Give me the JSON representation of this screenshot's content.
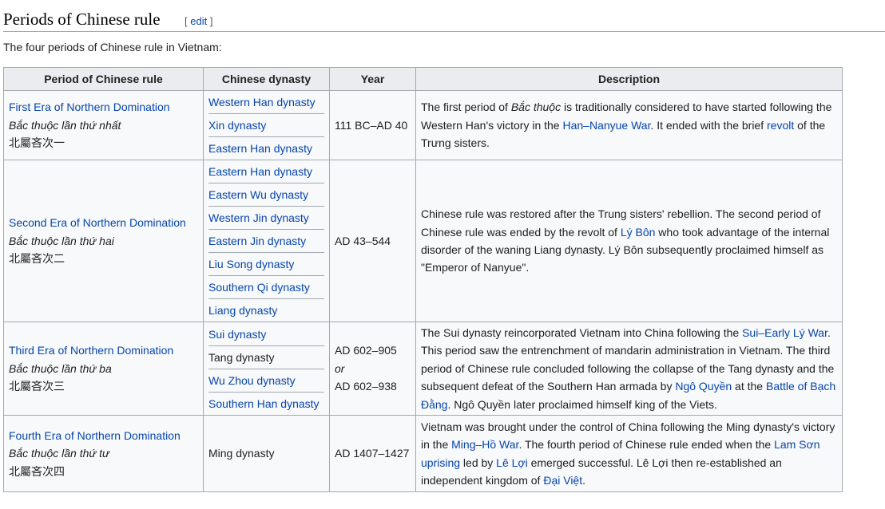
{
  "heading": {
    "title": "Periods of Chinese rule",
    "edit_open": "[",
    "edit_label": "edit",
    "edit_close": "]"
  },
  "intro": "The four periods of Chinese rule in Vietnam:",
  "table": {
    "headers": [
      "Period of Chinese rule",
      "Chinese dynasty",
      "Year",
      "Description"
    ],
    "rows": [
      {
        "period": "First Era of Northern Domination",
        "viet": "Bắc thuộc lần thứ nhất",
        "han": "北屬吝次一",
        "dynasties": [
          {
            "name": "Western Han dynasty",
            "link": true
          },
          {
            "name": "Xin dynasty",
            "link": true
          },
          {
            "name": "Eastern Han dynasty",
            "link": true
          }
        ],
        "year": "111 BC–AD 40",
        "desc": {
          "a": "The first period of ",
          "b": "Bắc thuộc",
          "c": " is traditionally considered to have started following the Western Han's victory in the ",
          "d": "Han–Nanyue War",
          "e": ". It ended with the brief ",
          "f": "revolt",
          "g": " of the ",
          "h": "Trưng sisters",
          "i": "."
        }
      },
      {
        "period": "Second Era of Northern Domination",
        "viet": "Bắc thuộc lần thứ hai",
        "han": "北屬吝次二",
        "dynasties": [
          {
            "name": "Eastern Han dynasty",
            "link": true
          },
          {
            "name": "Eastern Wu dynasty",
            "link": true
          },
          {
            "name": "Western Jin dynasty",
            "link": true
          },
          {
            "name": "Eastern Jin dynasty",
            "link": true
          },
          {
            "name": "Liu Song dynasty",
            "link": true
          },
          {
            "name": "Southern Qi dynasty",
            "link": true
          },
          {
            "name": "Liang dynasty",
            "link": true
          }
        ],
        "year": "AD 43–544",
        "desc": {
          "a": "Chinese rule was restored after the Trung sisters' rebellion. The second period of Chinese rule was ended by the revolt of ",
          "b": "Lý Bôn",
          "c": " who took advantage of the internal disorder of the waning Liang dynasty. Lý Bôn subsequently proclaimed himself as \"Emperor of Nanyue\"."
        }
      },
      {
        "period": "Third Era of Northern Domination",
        "viet": "Bắc thuộc lần thứ ba",
        "han": "北屬吝次三",
        "dynasties": [
          {
            "name": "Sui dynasty",
            "link": true
          },
          {
            "name": "Tang dynasty",
            "link": false
          },
          {
            "name": "Wu Zhou dynasty",
            "link": true
          },
          {
            "name": "Southern Han dynasty",
            "link": true
          }
        ],
        "year1": "AD 602–905",
        "year_or": "or",
        "year2": "AD 602–938",
        "desc": {
          "a": "The Sui dynasty reincorporated Vietnam into China following the ",
          "b": "Sui–Early Lý War",
          "c": ". This period saw the entrenchment of mandarin administration in Vietnam. The third period of Chinese rule concluded following the collapse of the Tang dynasty and the subsequent defeat of the Southern Han armada by ",
          "d": "Ngô Quyền",
          "e": " at the ",
          "f": "Battle of Bạch Đằng",
          "g": ". Ngô Quyền later proclaimed himself king of the Viets."
        }
      },
      {
        "period": "Fourth Era of Northern Domination",
        "viet": "Bắc thuộc lần thứ tư",
        "han": "北屬吝次四",
        "dynasties": [
          {
            "name": "Ming dynasty",
            "link": false
          }
        ],
        "year": "AD 1407–1427",
        "desc": {
          "a": "Vietnam was brought under the control of China following the Ming dynasty's victory in the ",
          "b": "Ming–Hồ War",
          "c": ". The fourth period of Chinese rule ended when the ",
          "d": "Lam Sơn uprising",
          "e": " led by ",
          "f": "Lê Lợi",
          "g": " emerged successful. Lê Lợi then re-established an independent kingdom of ",
          "h": "Đại Việt",
          "i": "."
        }
      }
    ]
  },
  "colors": {
    "link": "#0645ad",
    "header_bg": "#eaecf0",
    "cell_bg": "#f8f9fa",
    "border": "#a2a9b1"
  }
}
